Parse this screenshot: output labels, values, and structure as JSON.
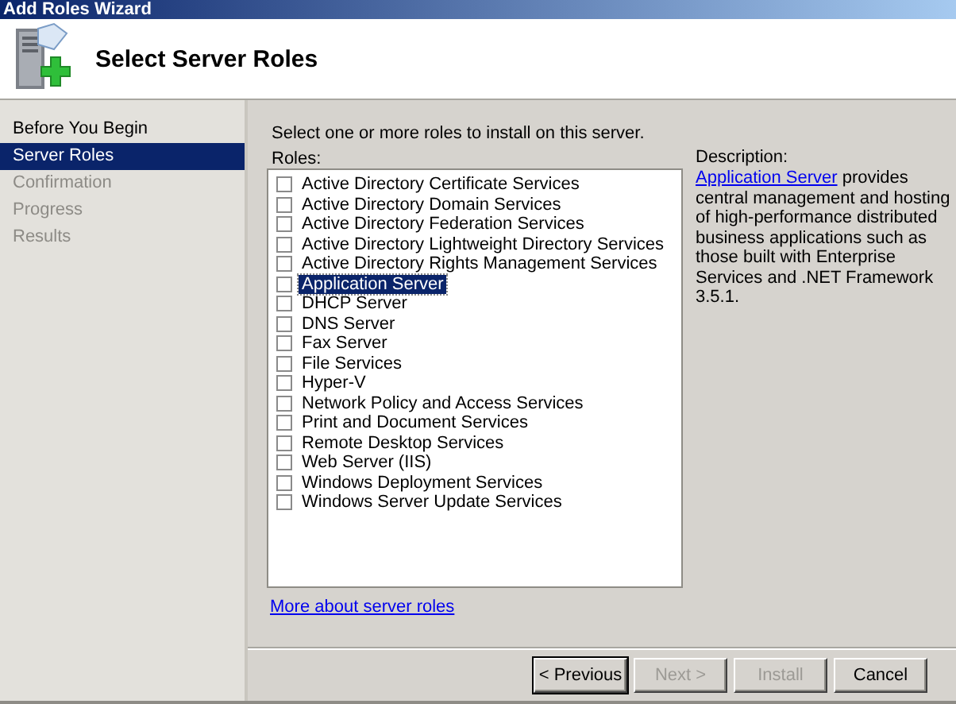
{
  "window": {
    "title": "Add Roles Wizard"
  },
  "header": {
    "title": "Select Server Roles"
  },
  "steps": [
    {
      "label": "Before You Begin",
      "selected": false,
      "disabled": false
    },
    {
      "label": "Server Roles",
      "selected": true,
      "disabled": false
    },
    {
      "label": "Confirmation",
      "selected": false,
      "disabled": true
    },
    {
      "label": "Progress",
      "selected": false,
      "disabled": true
    },
    {
      "label": "Results",
      "selected": false,
      "disabled": true
    }
  ],
  "instruction": "Select one or more roles to install on this server.",
  "roles_label": "Roles:",
  "roles": [
    {
      "label": "Active Directory Certificate Services",
      "checked": false,
      "selected": false
    },
    {
      "label": "Active Directory Domain Services",
      "checked": false,
      "selected": false
    },
    {
      "label": "Active Directory Federation Services",
      "checked": false,
      "selected": false
    },
    {
      "label": "Active Directory Lightweight Directory Services",
      "checked": false,
      "selected": false
    },
    {
      "label": "Active Directory Rights Management Services",
      "checked": false,
      "selected": false
    },
    {
      "label": "Application Server",
      "checked": false,
      "selected": true
    },
    {
      "label": "DHCP Server",
      "checked": false,
      "selected": false
    },
    {
      "label": "DNS Server",
      "checked": false,
      "selected": false
    },
    {
      "label": "Fax Server",
      "checked": false,
      "selected": false
    },
    {
      "label": "File Services",
      "checked": false,
      "selected": false
    },
    {
      "label": "Hyper-V",
      "checked": false,
      "selected": false
    },
    {
      "label": "Network Policy and Access Services",
      "checked": false,
      "selected": false
    },
    {
      "label": "Print and Document Services",
      "checked": false,
      "selected": false
    },
    {
      "label": "Remote Desktop Services",
      "checked": false,
      "selected": false
    },
    {
      "label": "Web Server (IIS)",
      "checked": false,
      "selected": false
    },
    {
      "label": "Windows Deployment Services",
      "checked": false,
      "selected": false
    },
    {
      "label": "Windows Server Update Services",
      "checked": false,
      "selected": false
    }
  ],
  "description": {
    "label": "Description:",
    "link": "Application Server",
    "text": "provides central management and hosting of high-performance distributed business applications such as those built with Enterprise Services and .NET Framework 3.5.1."
  },
  "more_link": "More about server roles",
  "buttons": [
    {
      "label": "< Previous",
      "disabled": false,
      "default": true
    },
    {
      "label": "Next >",
      "disabled": true,
      "default": false
    },
    {
      "label": "Install",
      "disabled": true,
      "default": false
    },
    {
      "label": "Cancel",
      "disabled": false,
      "default": false
    }
  ]
}
